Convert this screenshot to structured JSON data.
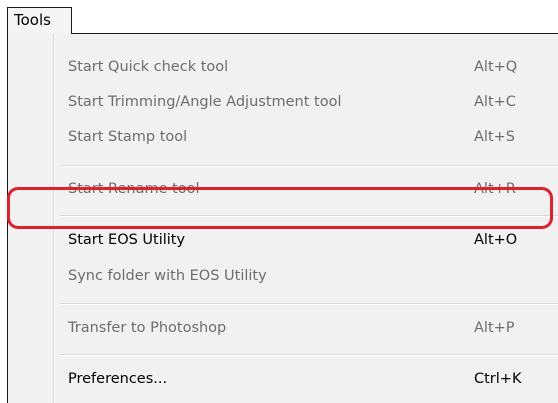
{
  "menubar": {
    "tools_label": "Tools"
  },
  "menu": {
    "items": [
      {
        "label": "Start Quick check tool",
        "shortcut": "Alt+Q",
        "enabled": false
      },
      {
        "label": "Start Trimming/Angle Adjustment tool",
        "shortcut": "Alt+C",
        "enabled": false
      },
      {
        "label": "Start Stamp tool",
        "shortcut": "Alt+S",
        "enabled": false
      },
      {
        "label": "Start Rename tool",
        "shortcut": "Alt+R",
        "enabled": false
      },
      {
        "label": "Start EOS Utility",
        "shortcut": "Alt+O",
        "enabled": true
      },
      {
        "label": "Sync folder with EOS Utility",
        "shortcut": "",
        "enabled": false
      },
      {
        "label": "Transfer to Photoshop",
        "shortcut": "Alt+P",
        "enabled": false
      },
      {
        "label": "Preferences...",
        "shortcut": "Ctrl+K",
        "enabled": true
      }
    ]
  },
  "annotation": {
    "highlight_color": "#e2202a",
    "highlighted_item": "Start EOS Utility"
  }
}
